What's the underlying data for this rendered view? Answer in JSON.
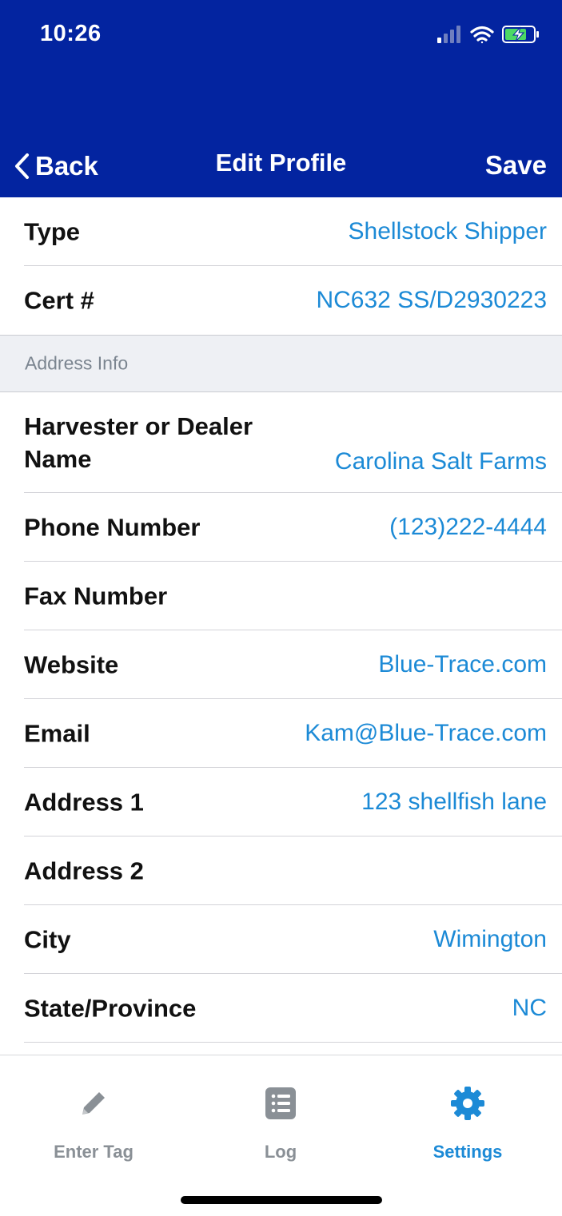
{
  "status_bar": {
    "time": "10:26"
  },
  "nav": {
    "back_label": "Back",
    "title": "Edit Profile",
    "save_label": "Save"
  },
  "rows_top": [
    {
      "label": "Type",
      "value": "Shellstock Shipper"
    },
    {
      "label": "Cert #",
      "value": "NC632 SS/D2930223"
    }
  ],
  "section": {
    "label": "Address Info"
  },
  "rows": [
    {
      "label": "Harvester or Dealer Name",
      "value": "Carolina Salt Farms"
    },
    {
      "label": "Phone Number",
      "value": "(123)222-4444"
    },
    {
      "label": "Fax Number",
      "value": ""
    },
    {
      "label": "Website",
      "value": "Blue-Trace.com"
    },
    {
      "label": "Email",
      "value": "Kam@Blue-Trace.com"
    },
    {
      "label": "Address 1",
      "value": "123 shellfish lane"
    },
    {
      "label": "Address 2",
      "value": ""
    },
    {
      "label": "City",
      "value": "Wimington"
    },
    {
      "label": "State/Province",
      "value": "NC"
    }
  ],
  "tabs": [
    {
      "label": "Enter Tag",
      "icon": "pencil-icon"
    },
    {
      "label": "Log",
      "icon": "list-icon"
    },
    {
      "label": "Settings",
      "icon": "gear-icon",
      "active": true
    }
  ],
  "colors": {
    "header": "#0324a0",
    "accent": "#1c8ad6",
    "inactive_tab": "#8a9096"
  }
}
